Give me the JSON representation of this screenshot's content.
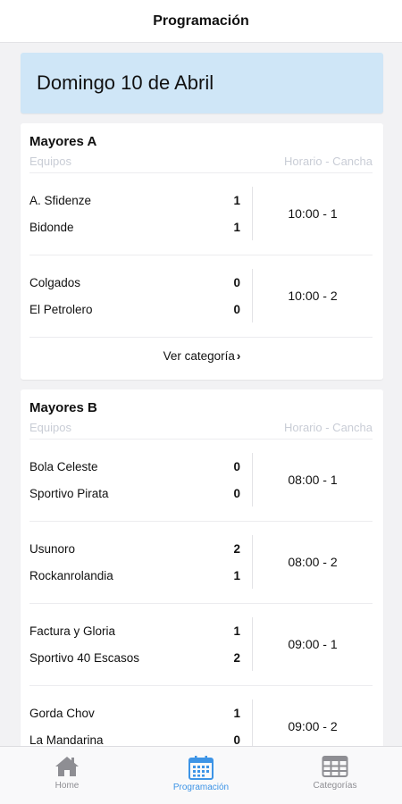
{
  "nav": {
    "title": "Programación"
  },
  "day": {
    "title": "Domingo 10 de Abril"
  },
  "columns": {
    "left": "Equipos",
    "right": "Horario - Cancha"
  },
  "categories": [
    {
      "name": "Mayores A",
      "matches": [
        {
          "home": "A. Sfidenze",
          "home_score": "1",
          "away": "Bidonde",
          "away_score": "1",
          "time": "10:00 - 1"
        },
        {
          "home": "Colgados",
          "home_score": "0",
          "away": "El Petrolero",
          "away_score": "0",
          "time": "10:00 - 2"
        }
      ],
      "link_label": "Ver categoría"
    },
    {
      "name": "Mayores B",
      "matches": [
        {
          "home": "Bola Celeste",
          "home_score": "0",
          "away": "Sportivo Pirata",
          "away_score": "0",
          "time": "08:00 - 1"
        },
        {
          "home": "Usunoro",
          "home_score": "2",
          "away": "Rockanrolandia",
          "away_score": "1",
          "time": "08:00 - 2"
        },
        {
          "home": "Factura y Gloria",
          "home_score": "1",
          "away": "Sportivo 40 Escasos",
          "away_score": "2",
          "time": "09:00 - 1"
        },
        {
          "home": "Gorda Chov",
          "home_score": "1",
          "away": "La Mandarina",
          "away_score": "0",
          "time": "09:00 - 2"
        }
      ]
    }
  ],
  "tabs": [
    {
      "label": "Home",
      "icon": "home-icon",
      "active": false
    },
    {
      "label": "Programación",
      "icon": "calendar-icon",
      "active": true
    },
    {
      "label": "Categorías",
      "icon": "table-grid-icon",
      "active": false
    }
  ],
  "colors": {
    "accent": "#3d94e6",
    "banner": "#cfe6f7",
    "inactive": "#8e8e93"
  }
}
